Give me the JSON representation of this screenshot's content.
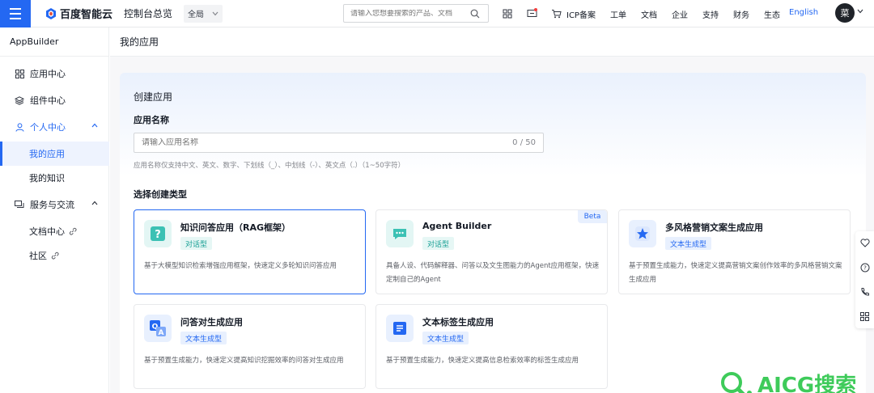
{
  "topbar": {
    "brand": "百度智能云",
    "console": "控制台总览",
    "region": "全局",
    "search_placeholder": "请输入您想要搜索的产品、文档",
    "links": [
      "ICP备案",
      "工单",
      "文档",
      "企业",
      "支持",
      "财务",
      "生态"
    ],
    "language": "English",
    "avatar_initial": "菜"
  },
  "sidebar": {
    "title": "AppBuilder",
    "items": [
      {
        "label": "应用中心",
        "icon": "grid-icon"
      },
      {
        "label": "组件中心",
        "icon": "layers-icon"
      },
      {
        "label": "个人中心",
        "icon": "user-icon"
      },
      {
        "label": "我的应用"
      },
      {
        "label": "我的知识"
      },
      {
        "label": "服务与交流",
        "icon": "chat-icon"
      },
      {
        "label": "文档中心"
      },
      {
        "label": "社区"
      }
    ]
  },
  "main": {
    "page_title": "我的应用",
    "section_title": "创建应用",
    "name_label": "应用名称",
    "name_placeholder": "请输入应用名称",
    "name_counter": "0 / 50",
    "name_hint": "应用名称仅支持中文、英文、数字、下划线（_）、中划线（-）、英文点（.）（1~50字符）",
    "type_title": "选择创建类型",
    "cards": [
      {
        "title": "知识问答应用（RAG框架）",
        "tag": "对话型",
        "desc": "基于大模型知识检索增强应用框架，快速定义多轮知识问答应用",
        "icon": "question-icon"
      },
      {
        "title": "Agent Builder",
        "tag": "对话型",
        "badge": "Beta",
        "desc": "具备人设、代码解释器、问答以及文生图能力的Agent应用框架，快速定制自己的Agent",
        "icon": "chat-bubble-icon"
      },
      {
        "title": "多风格营销文案生成应用",
        "tag": "文本生成型",
        "desc": "基于预置生成能力，快速定义提高营销文案创作效率的多风格营销文案生成应用",
        "icon": "star-icon"
      },
      {
        "title": "问答对生成应用",
        "tag": "文本生成型",
        "desc": "基于预置生成能力，快速定义提高知识挖掘效率的问答对生成应用",
        "icon": "qa-icon"
      },
      {
        "title": "文本标签生成应用",
        "tag": "文本生成型",
        "desc": "基于预置生成能力，快速定义提高信息检索效率的标签生成应用",
        "icon": "doc-icon"
      }
    ]
  },
  "watermark": "AICG搜索",
  "colors": {
    "primary": "#2468f2",
    "teal": "#1aa095",
    "watermark": "#3ecb5a"
  }
}
